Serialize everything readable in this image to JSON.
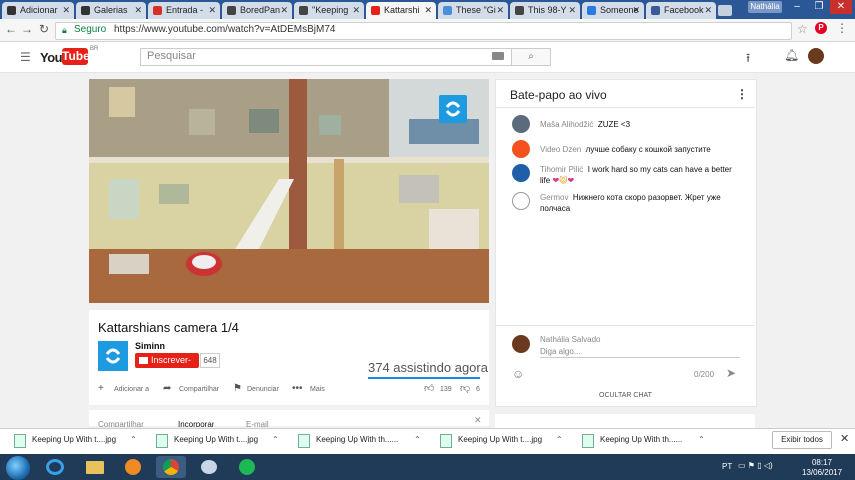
{
  "browser": {
    "tabs": [
      {
        "label": "Adicionar",
        "favicon_color": "#333333",
        "active": false
      },
      {
        "label": "Galerias",
        "favicon_color": "#333333",
        "active": false
      },
      {
        "label": "Entrada -",
        "favicon_color": "#d93025",
        "active": false
      },
      {
        "label": "BoredPan",
        "favicon_color": "#444444",
        "active": false
      },
      {
        "label": "\"Keeping",
        "favicon_color": "#444444",
        "active": false
      },
      {
        "label": "Kattarshi",
        "favicon_color": "#e62117",
        "active": true
      },
      {
        "label": "These \"Gi",
        "favicon_color": "#4a90d9",
        "active": false
      },
      {
        "label": "This 98-Y",
        "favicon_color": "#444444",
        "active": false
      },
      {
        "label": "Someone",
        "favicon_color": "#2a7ae2",
        "active": false
      },
      {
        "label": "Facebook",
        "favicon_color": "#3b5998",
        "active": false
      }
    ],
    "profile_name": "Nathália",
    "address": {
      "secure_label": "Seguro",
      "url": "https://www.youtube.com/watch?v=AtDEMsBjM74"
    }
  },
  "youtube": {
    "logo_you": "You",
    "logo_tube": "Tube",
    "logo_region": "BR",
    "search_placeholder": "Pesquisar",
    "video": {
      "title": "Kattarshians camera 1/4",
      "channel": "Siminn",
      "subscribe_label": "Inscrever-se",
      "subscriber_count": "648",
      "viewers": "374 assistindo agora",
      "actions": {
        "add": "Adicionar a",
        "share": "Compartilhar",
        "report": "Denunciar",
        "more": "Mais"
      },
      "likes": "139",
      "dislikes": "6"
    },
    "lower_tabs": [
      "Compartilhar",
      "Incorporar",
      "E-mail"
    ]
  },
  "chat": {
    "header": "Bate-papo ao vivo",
    "messages": [
      {
        "author": "Maša Alihodžić",
        "text": "ZUZE <3",
        "avatar_color": "#5b6b7b"
      },
      {
        "author": "Video Dzen",
        "text": "лучше собаку с кошкой запустите",
        "avatar_color": "#f4511e"
      },
      {
        "author": "Tihomir Pilić",
        "text": "I work hard so my cats can have a better life",
        "avatar_color": "#1e5fa8"
      },
      {
        "author": "Germov",
        "text": "Нижнего кота скоро разорвет. Жрет уже полчаса",
        "avatar_color": "#ffffff"
      }
    ],
    "me_name": "Nathália Salvado",
    "input_placeholder": "Diga algo...",
    "counter": "0/200",
    "hide_label": "OCULTAR CHAT"
  },
  "downloads": {
    "items": [
      "Keeping Up With t....jpg",
      "Keeping Up With t....jpg",
      "Keeping Up With th......",
      "Keeping Up With t....jpg",
      "Keeping Up With th......"
    ],
    "show_all": "Exibir todos"
  },
  "taskbar": {
    "language": "PT",
    "time": "08:17",
    "date": "13/06/2017"
  },
  "colors": {
    "youtube_red": "#e62117",
    "link_blue": "#1e88e5",
    "taskbar": "#1f3b57",
    "tabstrip": "#2b5797"
  }
}
